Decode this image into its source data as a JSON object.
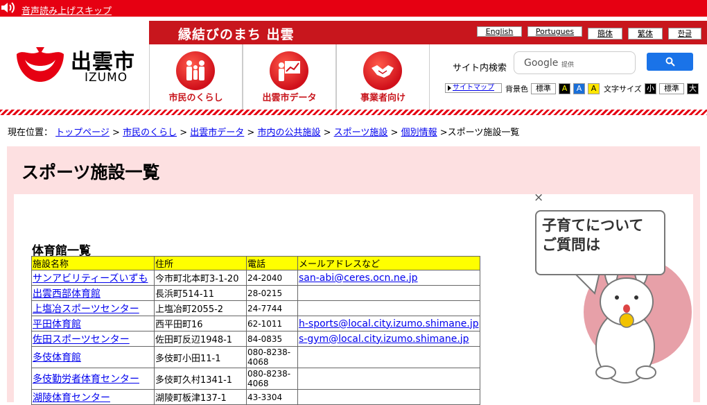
{
  "skip": {
    "label": "音声読み上げスキップ"
  },
  "logo": {
    "jp": "出雲市",
    "en": "IZUMO"
  },
  "header": {
    "catch": "縁結びのまち 出雲"
  },
  "languages": [
    "English",
    "Portugues",
    "簡体",
    "繁体",
    "한글"
  ],
  "nav": [
    {
      "label": "市民のくらし",
      "icon": "family-icon"
    },
    {
      "label": "出雲市データ",
      "icon": "chart-presentation-icon"
    },
    {
      "label": "事業者向け",
      "icon": "handshake-icon"
    }
  ],
  "search": {
    "label": "サイト内検索",
    "google": "Google",
    "provided": "提供"
  },
  "tools": {
    "sitemap": "サイトマップ",
    "bg_label": "背景色",
    "bg_standard": "標準",
    "bg_a": "A",
    "font_label": "文字サイズ",
    "font_small": "小",
    "font_standard": "標準",
    "font_large": "大"
  },
  "breadcrumb": {
    "prefix": "現在位置：",
    "items": [
      "トップページ",
      "市民のくらし",
      "出雲市データ",
      "市内の公共施設",
      "スポーツ施設",
      "個別情報"
    ],
    "current": "スポーツ施設一覧"
  },
  "page": {
    "title": "スポーツ施設一覧",
    "section": "体育館一覧"
  },
  "table": {
    "headers": [
      "施設名称",
      "住所",
      "電話",
      "メールアドレスなど"
    ],
    "rows": [
      {
        "name": "サンアビリティーズいずも",
        "addr": "今市町北本町3-1-20",
        "tel": "24-2040",
        "mail": "san-abi@ceres.ocn.ne.jp"
      },
      {
        "name": "出雲西部体育館",
        "addr": "長浜町514-11",
        "tel": "28-0215",
        "mail": ""
      },
      {
        "name": "上塩冶スポーツセンター",
        "addr": "上塩冶町2055-2",
        "tel": "24-7744",
        "mail": ""
      },
      {
        "name": "平田体育館",
        "addr": "西平田町16",
        "tel": "62-1011",
        "mail": "h-sports@local.city.izumo.shimane.jp"
      },
      {
        "name": "佐田スポーツセンター",
        "addr": "佐田町反辺1948-1",
        "tel": "84-0835",
        "mail": "s-gym@local.city.izumo.shimane.jp "
      },
      {
        "name": "多伎体育館",
        "addr": "多伎町小田11-1",
        "tel": "080-8238-4068",
        "mail": ""
      },
      {
        "name": "多伎勤労者体育センター",
        "addr": "多伎町久村1341-1",
        "tel": "080-8238-4068",
        "mail": ""
      },
      {
        "name": "湖陵体育センター",
        "addr": "湖陵町板津137-1",
        "tel": "43-3304",
        "mail": ""
      }
    ]
  },
  "mascot": {
    "bubble_line1": "子育てについて",
    "bubble_line2": "ご質問は",
    "close": "×"
  },
  "colors": {
    "brand_red": "#e60012",
    "title_bg": "#fde0e1",
    "header_yellow": "#ffff00"
  }
}
